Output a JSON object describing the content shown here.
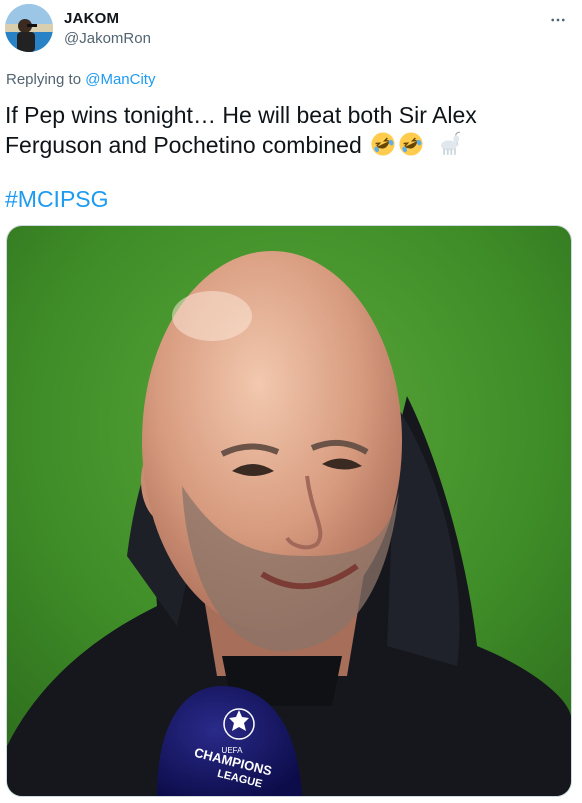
{
  "user": {
    "display_name": "JAKOM",
    "handle": "@JakomRon",
    "avatar_icon": "avatar-photo"
  },
  "reply": {
    "prefix": "Replying to",
    "mention": "@ManCity"
  },
  "tweet": {
    "text": "If Pep wins tonight… He will beat both Sir Alex Ferguson and Pochetino combined",
    "emojis": [
      "rolling-on-floor-laughing-emoji",
      "rolling-on-floor-laughing-emoji",
      "goat-emoji"
    ],
    "hashtag": "#MCIPSG"
  },
  "media": {
    "mic_text_line1": "CHAMPIONS",
    "mic_text_line2": "LEAGUE",
    "mic_text_small": "UEFA"
  },
  "colors": {
    "link": "#1d9bf0",
    "text": "#0f1419",
    "secondary": "#536471",
    "pitch_green": "#4a9a2c"
  },
  "icons": {
    "more": "more-dots-icon"
  }
}
